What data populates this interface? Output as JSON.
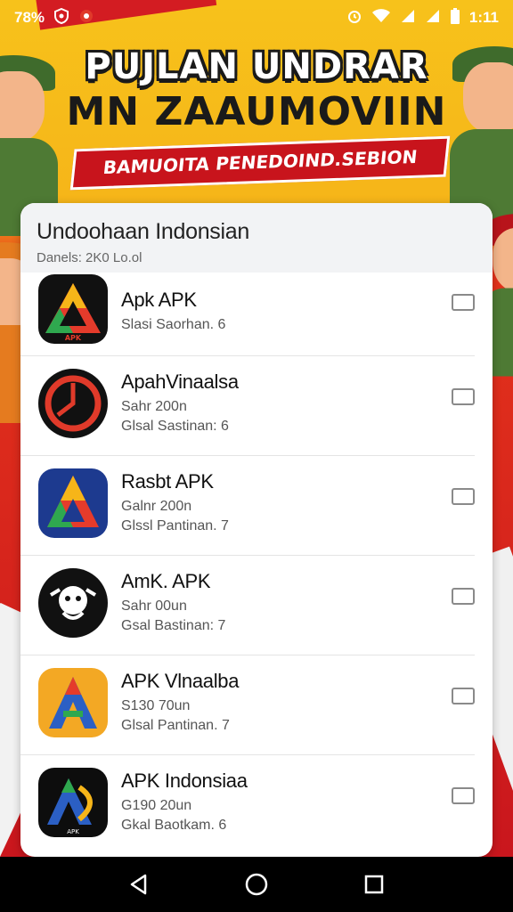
{
  "status_bar": {
    "battery_text": "78%",
    "time": "1:11",
    "icons": [
      "shield-icon",
      "notification-icon",
      "alarm-icon",
      "wifi-icon",
      "signal-icon",
      "signal-icon",
      "battery-icon"
    ]
  },
  "banner": {
    "title_line1": "PUJLAN UNDRAR",
    "title_line2": "MN ZAAUMOVIIN",
    "subtitle": "BAMUOITA PENEDOIND.SEBION"
  },
  "card": {
    "title": "Undoohaan Indonsian",
    "subtitle": "Danels: 2K0 Lo.ol"
  },
  "apps": [
    {
      "name": "Apk APK",
      "line1": "Slasi Saorhan. 6",
      "line2": "",
      "icon": "triangle-a-icon",
      "bg": "#111111"
    },
    {
      "name": "ApahVinaalsa",
      "line1": "Sahr 200n",
      "line2": "Glsal Sastinan: 6",
      "icon": "clock-ring-icon",
      "bg": "#111111"
    },
    {
      "name": "Rasbt APK",
      "line1": "Galnr 200n",
      "line2": "Glssl Pantinan. 7",
      "icon": "triangle-a-icon",
      "bg": "#1d3a8f"
    },
    {
      "name": "AmK. APK",
      "line1": "Sahr 00un",
      "line2": "Gsal Bastinan: 7",
      "icon": "mascot-icon",
      "bg": "#111111"
    },
    {
      "name": "APK Vlnaalba",
      "line1": "S130 70un",
      "line2": "Glsal Pantinan. 7",
      "icon": "letter-a-icon",
      "bg": "#f3a824"
    },
    {
      "name": "APK Indonsiaa",
      "line1": "G190 20un",
      "line2": "Gkal Baotkam. 6",
      "icon": "letter-a-icon",
      "bg": "#0d0d0d"
    }
  ],
  "nav": {
    "icons": [
      "back-icon",
      "home-icon",
      "recents-icon"
    ]
  },
  "colors": {
    "banner_yellow": "#f6b519",
    "banner_red": "#c8141c",
    "accent_blue": "#1b4ea0"
  }
}
